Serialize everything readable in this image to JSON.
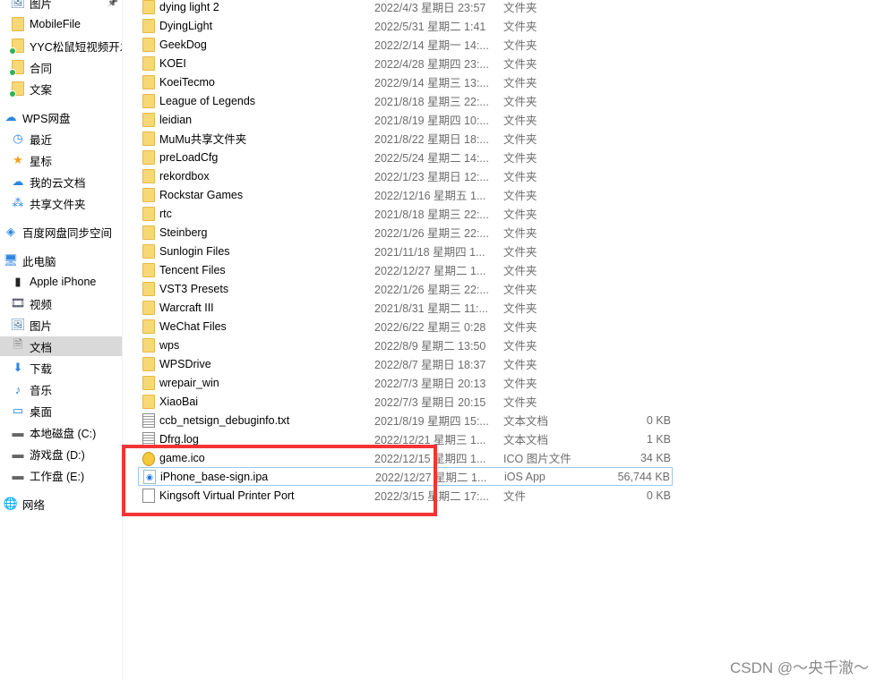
{
  "sidebar": {
    "items": [
      {
        "label": "图片",
        "icon": "pictures-icon",
        "indent": 1,
        "pinned": true
      },
      {
        "label": "MobileFile",
        "icon": "folder-icon",
        "indent": 1
      },
      {
        "label": "YYC松鼠短视频开发",
        "icon": "folder-synced-icon",
        "indent": 1
      },
      {
        "label": "合同",
        "icon": "folder-synced-icon",
        "indent": 1
      },
      {
        "label": "文案",
        "icon": "folder-synced-icon",
        "indent": 1
      },
      {
        "label": "WPS网盘",
        "icon": "cloud-icon",
        "indent": 0,
        "gap": true
      },
      {
        "label": "最近",
        "icon": "clock-icon",
        "indent": 1
      },
      {
        "label": "星标",
        "icon": "star-icon",
        "indent": 1
      },
      {
        "label": "我的云文档",
        "icon": "cloud-icon",
        "indent": 1
      },
      {
        "label": "共享文件夹",
        "icon": "share-icon",
        "indent": 1
      },
      {
        "label": "百度网盘同步空间",
        "icon": "baidu-drive-icon",
        "indent": 0,
        "gap": true
      },
      {
        "label": "此电脑",
        "icon": "computer-icon",
        "indent": 0,
        "gap": true
      },
      {
        "label": "Apple iPhone",
        "icon": "phone-icon",
        "indent": 1
      },
      {
        "label": "视频",
        "icon": "video-icon",
        "indent": 1
      },
      {
        "label": "图片",
        "icon": "pictures-icon",
        "indent": 1
      },
      {
        "label": "文档",
        "icon": "documents-icon",
        "indent": 1,
        "selected": true
      },
      {
        "label": "下载",
        "icon": "download-icon",
        "indent": 1
      },
      {
        "label": "音乐",
        "icon": "music-icon",
        "indent": 1
      },
      {
        "label": "桌面",
        "icon": "desktop-icon",
        "indent": 1
      },
      {
        "label": "本地磁盘 (C:)",
        "icon": "drive-icon",
        "indent": 1
      },
      {
        "label": "游戏盘 (D:)",
        "icon": "drive-icon",
        "indent": 1
      },
      {
        "label": "工作盘 (E:)",
        "icon": "drive-icon",
        "indent": 1
      },
      {
        "label": "网络",
        "icon": "network-icon",
        "indent": 0,
        "gap": true
      }
    ]
  },
  "files": [
    {
      "name": "dying light 2",
      "date": "2022/4/3 星期日 23:57",
      "type": "文件夹",
      "size": "",
      "kind": "folder"
    },
    {
      "name": "DyingLight",
      "date": "2022/5/31 星期二 1:41",
      "type": "文件夹",
      "size": "",
      "kind": "folder"
    },
    {
      "name": "GeekDog",
      "date": "2022/2/14 星期一 14:...",
      "type": "文件夹",
      "size": "",
      "kind": "folder"
    },
    {
      "name": "KOEI",
      "date": "2022/4/28 星期四 23:...",
      "type": "文件夹",
      "size": "",
      "kind": "folder"
    },
    {
      "name": "KoeiTecmo",
      "date": "2022/9/14 星期三 13:...",
      "type": "文件夹",
      "size": "",
      "kind": "folder"
    },
    {
      "name": "League of Legends",
      "date": "2021/8/18 星期三 22:...",
      "type": "文件夹",
      "size": "",
      "kind": "folder"
    },
    {
      "name": "leidian",
      "date": "2021/8/19 星期四 10:...",
      "type": "文件夹",
      "size": "",
      "kind": "folder"
    },
    {
      "name": "MuMu共享文件夹",
      "date": "2021/8/22 星期日 18:...",
      "type": "文件夹",
      "size": "",
      "kind": "folder"
    },
    {
      "name": "preLoadCfg",
      "date": "2022/5/24 星期二 14:...",
      "type": "文件夹",
      "size": "",
      "kind": "folder"
    },
    {
      "name": "rekordbox",
      "date": "2022/1/23 星期日 12:...",
      "type": "文件夹",
      "size": "",
      "kind": "folder"
    },
    {
      "name": "Rockstar Games",
      "date": "2022/12/16 星期五 1...",
      "type": "文件夹",
      "size": "",
      "kind": "folder"
    },
    {
      "name": "rtc",
      "date": "2021/8/18 星期三 22:...",
      "type": "文件夹",
      "size": "",
      "kind": "folder"
    },
    {
      "name": "Steinberg",
      "date": "2022/1/26 星期三 22:...",
      "type": "文件夹",
      "size": "",
      "kind": "folder"
    },
    {
      "name": "Sunlogin Files",
      "date": "2021/11/18 星期四 1...",
      "type": "文件夹",
      "size": "",
      "kind": "folder"
    },
    {
      "name": "Tencent Files",
      "date": "2022/12/27 星期二 1...",
      "type": "文件夹",
      "size": "",
      "kind": "folder"
    },
    {
      "name": "VST3 Presets",
      "date": "2022/1/26 星期三 22:...",
      "type": "文件夹",
      "size": "",
      "kind": "folder"
    },
    {
      "name": "Warcraft III",
      "date": "2021/8/31 星期二 11:...",
      "type": "文件夹",
      "size": "",
      "kind": "folder"
    },
    {
      "name": "WeChat Files",
      "date": "2022/6/22 星期三 0:28",
      "type": "文件夹",
      "size": "",
      "kind": "folder"
    },
    {
      "name": "wps",
      "date": "2022/8/9 星期二 13:50",
      "type": "文件夹",
      "size": "",
      "kind": "folder"
    },
    {
      "name": "WPSDrive",
      "date": "2022/8/7 星期日 18:37",
      "type": "文件夹",
      "size": "",
      "kind": "folder"
    },
    {
      "name": "wrepair_win",
      "date": "2022/7/3 星期日 20:13",
      "type": "文件夹",
      "size": "",
      "kind": "folder"
    },
    {
      "name": "XiaoBai",
      "date": "2022/7/3 星期日 20:15",
      "type": "文件夹",
      "size": "",
      "kind": "folder"
    },
    {
      "name": "ccb_netsign_debuginfo.txt",
      "date": "2021/8/19 星期四 15:...",
      "type": "文本文档",
      "size": "0 KB",
      "kind": "text"
    },
    {
      "name": "Dfrg.log",
      "date": "2022/12/21 星期三 1...",
      "type": "文本文档",
      "size": "1 KB",
      "kind": "text"
    },
    {
      "name": "game.ico",
      "date": "2022/12/15 星期四 1...",
      "type": "ICO 图片文件",
      "size": "34 KB",
      "kind": "ico"
    },
    {
      "name": "iPhone_base-sign.ipa",
      "date": "2022/12/27 星期二 1...",
      "type": "iOS App",
      "size": "56,744 KB",
      "kind": "ipa",
      "selected": true
    },
    {
      "name": "Kingsoft Virtual Printer Port",
      "date": "2022/3/15 星期二 17:...",
      "type": "文件",
      "size": "0 KB",
      "kind": "file"
    }
  ],
  "highlight_color": "#f43434",
  "watermark": "CSDN @～央千澈～"
}
